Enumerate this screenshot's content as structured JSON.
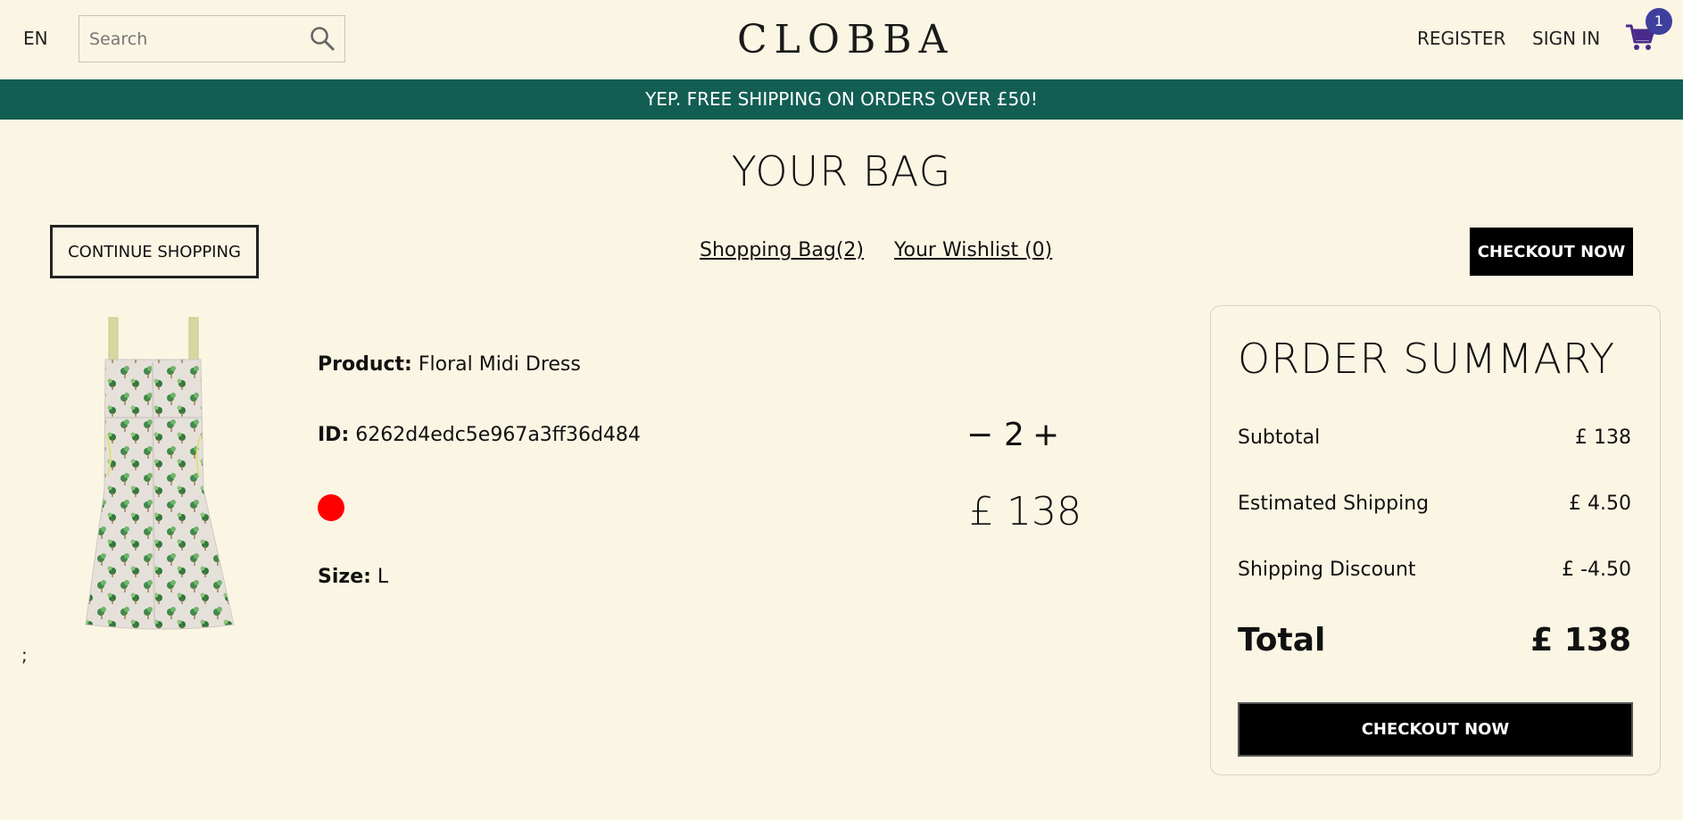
{
  "navbar": {
    "language": "EN",
    "search_placeholder": "Search",
    "logo": "CLOBBA",
    "register": "REGISTER",
    "sign_in": "SIGN IN",
    "cart_count": "1"
  },
  "announcement": "YEP. FREE SHIPPING ON ORDERS OVER £50!",
  "page": {
    "title": "YOUR BAG",
    "continue_shopping": "CONTINUE SHOPPING",
    "shopping_bag_link": "Shopping Bag(2)",
    "wishlist_link": "Your Wishlist (0)",
    "checkout_top": "CHECKOUT NOW",
    "stray_text": ";"
  },
  "product": {
    "product_label": "Product:",
    "product_name": "Floral Midi Dress",
    "id_label": "ID:",
    "id_value": "6262d4edc5e967a3ff36d484",
    "color": "#ff0000",
    "size_label": "Size:",
    "size_value": "L",
    "qty_minus": "−",
    "quantity": "2",
    "qty_plus": "+",
    "price": "£ 138"
  },
  "summary": {
    "title": "ORDER SUMMARY",
    "subtotal_label": "Subtotal",
    "subtotal_value": "£ 138",
    "shipping_label": "Estimated Shipping",
    "shipping_value": "£ 4.50",
    "discount_label": "Shipping Discount",
    "discount_value": "£ -4.50",
    "total_label": "Total",
    "total_value": "£ 138",
    "checkout_button": "CHECKOUT NOW"
  },
  "colors": {
    "background": "#fbf5e4",
    "announcement_bg": "#135e53",
    "cart_icon": "#4a2a8a",
    "cart_badge": "#3f3f9e",
    "button_bg": "#000000"
  }
}
